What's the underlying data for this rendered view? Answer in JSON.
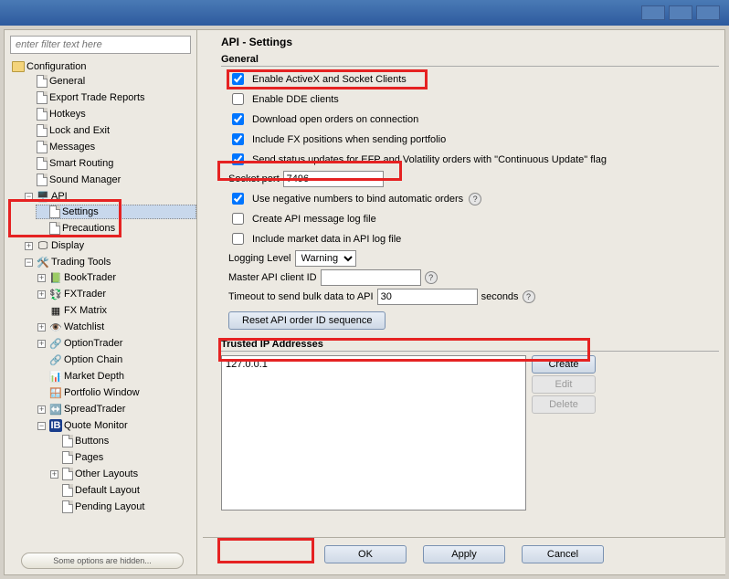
{
  "title": "API - Settings",
  "filterPlaceholder": "enter filter text here",
  "hiddenBar": "Some options are hidden...",
  "sidebar": {
    "root": "Configuration",
    "items": [
      "General",
      "Export Trade Reports",
      "Hotkeys",
      "Lock and Exit",
      "Messages",
      "Smart Routing",
      "Sound Manager"
    ],
    "api": {
      "label": "API",
      "children": [
        "Settings",
        "Precautions"
      ],
      "selected": "Settings"
    },
    "display": "Display",
    "trading": {
      "label": "Trading Tools",
      "children": [
        "BookTrader",
        "FXTrader",
        "FX Matrix",
        "Watchlist",
        "OptionTrader",
        "Option Chain",
        "Market Depth",
        "Portfolio Window",
        "SpreadTrader"
      ],
      "quote": {
        "label": "Quote Monitor",
        "children": [
          "Buttons",
          "Pages",
          "Other Layouts",
          "Default Layout",
          "Pending Layout"
        ]
      }
    }
  },
  "general": {
    "title": "General",
    "chk": {
      "activex": {
        "label": "Enable ActiveX and Socket Clients",
        "checked": true
      },
      "dde": {
        "label": "Enable DDE clients",
        "checked": false
      },
      "download": {
        "label": "Download open orders on connection",
        "checked": true
      },
      "fx": {
        "label": "Include FX positions when sending portfolio",
        "checked": true
      },
      "efp": {
        "label": "Send status updates for EFP and Volatility orders with \"Continuous Update\" flag",
        "checked": true
      },
      "neg": {
        "label": "Use negative numbers to bind automatic orders",
        "checked": true
      },
      "createlog": {
        "label": "Create API message log file",
        "checked": false
      },
      "mktdata": {
        "label": "Include market data in API log file",
        "checked": false
      }
    },
    "socketPort": {
      "label": "Socket port",
      "value": "7496"
    },
    "loggingLevel": {
      "label": "Logging Level",
      "value": "Warning"
    },
    "masterId": {
      "label": "Master API client ID",
      "value": ""
    },
    "timeout": {
      "label": "Timeout to send bulk data to API",
      "value": "30",
      "suffix": "seconds"
    },
    "resetBtn": "Reset API order ID sequence"
  },
  "trusted": {
    "title": "Trusted IP Addresses",
    "entries": [
      "127.0.0.1"
    ],
    "btnCreate": "Create",
    "btnEdit": "Edit",
    "btnDelete": "Delete"
  },
  "footer": {
    "ok": "OK",
    "apply": "Apply",
    "cancel": "Cancel"
  }
}
